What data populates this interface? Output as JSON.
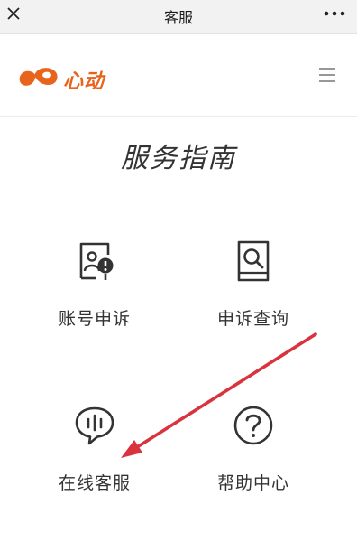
{
  "topbar": {
    "title": "客服",
    "close_icon": "close-icon",
    "more_icon": "more-icon"
  },
  "site": {
    "logo_text": "心动",
    "brand_color": "#e8641c",
    "menu_icon": "hamburger-menu-icon"
  },
  "page": {
    "title": "服务指南"
  },
  "services": [
    {
      "label": "账号申诉",
      "icon": "account-appeal-icon"
    },
    {
      "label": "申诉查询",
      "icon": "appeal-search-icon"
    },
    {
      "label": "在线客服",
      "icon": "online-chat-icon"
    },
    {
      "label": "帮助中心",
      "icon": "help-question-icon"
    }
  ],
  "annotation": {
    "arrow_color": "#d9333f",
    "points_to": "在线客服"
  }
}
